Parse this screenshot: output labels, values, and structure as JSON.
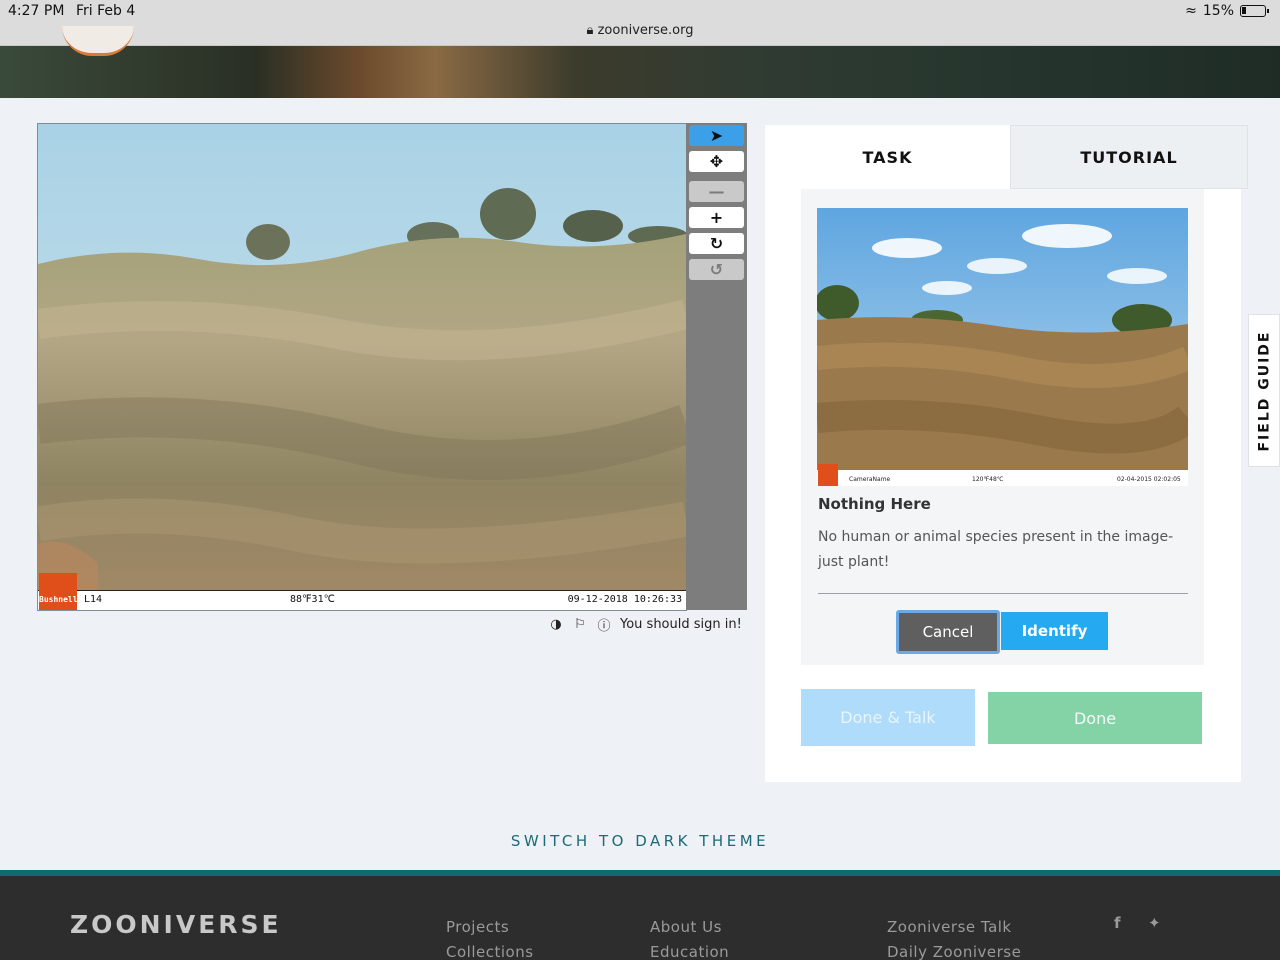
{
  "status_bar": {
    "time": "4:27 PM",
    "date": "Fri Feb 4",
    "url": "zooniverse.org",
    "battery": "15%"
  },
  "viewer": {
    "strip_left": "L14",
    "strip_mid": "88℉31℃",
    "strip_right": "09-12-2018 10:26:33",
    "brand": "Bushnell"
  },
  "toolbar": {
    "tools": [
      "pointer-icon",
      "move-icon",
      "zoom-out-icon",
      "zoom-in-icon",
      "rotate-icon",
      "reset-icon"
    ]
  },
  "meta": {
    "sign_in_text": "You should sign in!"
  },
  "tabs": {
    "task": "TASK",
    "tutorial": "TUTORIAL"
  },
  "card": {
    "title": "Nothing Here",
    "description": "No human or animal species present in the image- just plant!",
    "thumb_strip_left": "CameraName",
    "thumb_strip_mid": "120℉48℃",
    "thumb_strip_right": "02-04-2015 02:02:05",
    "cancel": "Cancel",
    "identify": "Identify"
  },
  "actions": {
    "done_talk": "Done & Talk",
    "done": "Done"
  },
  "field_guide": "FIELD GUIDE",
  "theme_link": "SWITCH TO DARK THEME",
  "footer": {
    "brand": "ZOONIVERSE",
    "col1": [
      "Projects",
      "Collections"
    ],
    "col2": [
      "About Us",
      "Education"
    ],
    "col3": [
      "Zooniverse Talk",
      "Daily Zooniverse"
    ],
    "social": [
      "f",
      "twitter-icon"
    ]
  },
  "colors": {
    "accent": "#25a9f0",
    "done": "#84d3a6",
    "footer": "#2d2d2d",
    "teal": "#0f6b73"
  }
}
